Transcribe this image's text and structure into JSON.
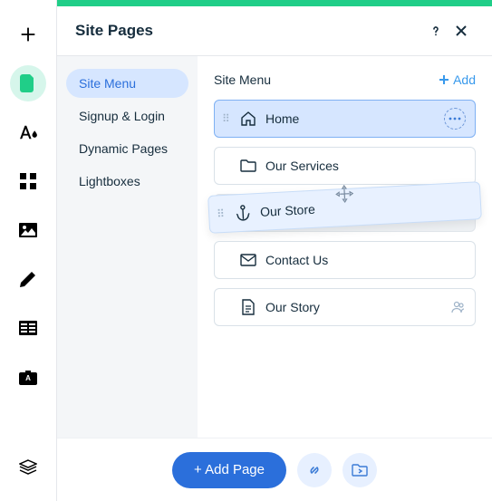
{
  "header": {
    "title": "Site Pages"
  },
  "side_nav": {
    "items": [
      {
        "label": "Site Menu"
      },
      {
        "label": "Signup & Login"
      },
      {
        "label": "Dynamic Pages"
      },
      {
        "label": "Lightboxes"
      }
    ]
  },
  "section": {
    "title": "Site Menu",
    "add_label": "Add"
  },
  "pages": {
    "items": [
      {
        "label": "Home"
      },
      {
        "label": "Our Services"
      },
      {
        "label": "Our Store"
      },
      {
        "label": "Contact Us"
      },
      {
        "label": "Our Story"
      }
    ]
  },
  "footer": {
    "add_page_label": "+ Add Page"
  }
}
